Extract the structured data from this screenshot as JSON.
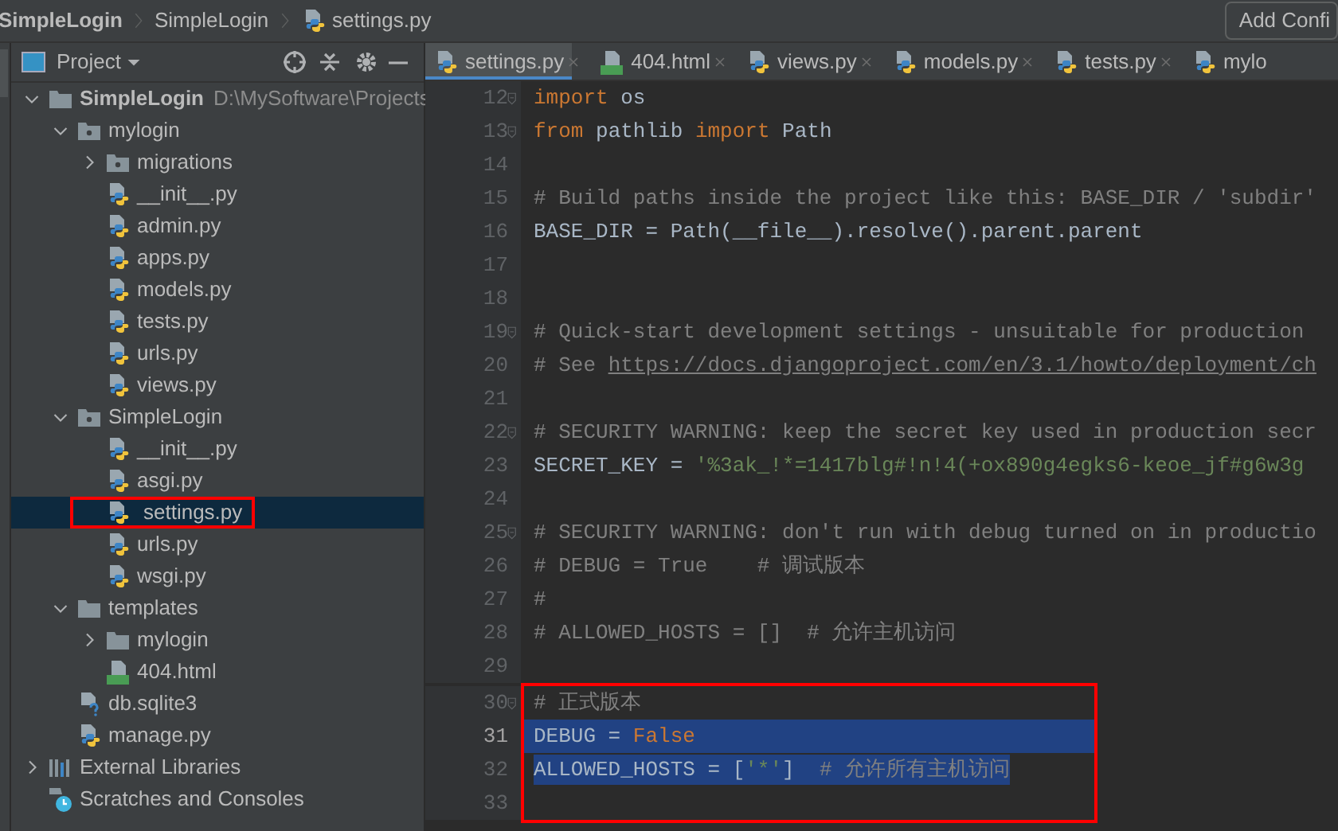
{
  "breadcrumb": [
    {
      "label": "SimpleLogin",
      "kind": "plain"
    },
    {
      "label": "SimpleLogin",
      "kind": "plain"
    },
    {
      "label": "settings.py",
      "kind": "python"
    }
  ],
  "toolbar_button": "Add Confi",
  "project_panel": {
    "title": "Project",
    "tree": [
      {
        "label": "SimpleLogin",
        "path": "D:\\MySoftware\\Projects",
        "kind": "folder",
        "expanded": true,
        "selected": false,
        "annotated": false,
        "children": [
          {
            "label": "mylogin",
            "kind": "package",
            "expanded": true,
            "selected": false,
            "annotated": false,
            "children": [
              {
                "label": "migrations",
                "kind": "package",
                "expanded": false,
                "selected": false,
                "annotated": false
              },
              {
                "label": "__init__.py",
                "kind": "python",
                "selected": false,
                "annotated": false
              },
              {
                "label": "admin.py",
                "kind": "python",
                "selected": false,
                "annotated": false
              },
              {
                "label": "apps.py",
                "kind": "python",
                "selected": false,
                "annotated": false
              },
              {
                "label": "models.py",
                "kind": "python",
                "selected": false,
                "annotated": false
              },
              {
                "label": "tests.py",
                "kind": "python",
                "selected": false,
                "annotated": false
              },
              {
                "label": "urls.py",
                "kind": "python",
                "selected": false,
                "annotated": false
              },
              {
                "label": "views.py",
                "kind": "python",
                "selected": false,
                "annotated": false
              }
            ]
          },
          {
            "label": "SimpleLogin",
            "kind": "package",
            "expanded": true,
            "selected": false,
            "annotated": false,
            "children": [
              {
                "label": "__init__.py",
                "kind": "python",
                "selected": false,
                "annotated": false
              },
              {
                "label": "asgi.py",
                "kind": "python",
                "selected": false,
                "annotated": false
              },
              {
                "label": "settings.py",
                "kind": "python",
                "selected": true,
                "annotated": true
              },
              {
                "label": "urls.py",
                "kind": "python",
                "selected": false,
                "annotated": false
              },
              {
                "label": "wsgi.py",
                "kind": "python",
                "selected": false,
                "annotated": false
              }
            ]
          },
          {
            "label": "templates",
            "kind": "folder",
            "expanded": true,
            "selected": false,
            "annotated": false,
            "children": [
              {
                "label": "mylogin",
                "kind": "folder",
                "expanded": false,
                "selected": false,
                "annotated": false
              },
              {
                "label": "404.html",
                "kind": "html",
                "selected": false,
                "annotated": false
              }
            ]
          },
          {
            "label": "db.sqlite3",
            "kind": "unknown",
            "selected": false,
            "annotated": false
          },
          {
            "label": "manage.py",
            "kind": "python",
            "selected": false,
            "annotated": false
          }
        ]
      },
      {
        "label": "External Libraries",
        "kind": "libraries",
        "expanded": false,
        "selected": false,
        "annotated": false
      },
      {
        "label": "Scratches and Consoles",
        "kind": "scratches",
        "selected": false,
        "annotated": false
      }
    ]
  },
  "tabs": [
    {
      "label": "settings.py",
      "kind": "python",
      "selected": true
    },
    {
      "label": "404.html",
      "kind": "html",
      "selected": false
    },
    {
      "label": "views.py",
      "kind": "python",
      "selected": false
    },
    {
      "label": "models.py",
      "kind": "python",
      "selected": false
    },
    {
      "label": "tests.py",
      "kind": "python",
      "selected": false
    },
    {
      "label": "mylo",
      "kind": "python",
      "selected": false
    }
  ],
  "code_lines": [
    {
      "number": "12",
      "fold": true,
      "current": false,
      "selected": false,
      "boxed": false,
      "tokens": [
        {
          "kind": "keyword",
          "text": "import"
        },
        {
          "kind": "plain",
          "text": " os"
        }
      ]
    },
    {
      "number": "13",
      "fold": true,
      "current": false,
      "selected": false,
      "boxed": false,
      "tokens": [
        {
          "kind": "keyword",
          "text": "from"
        },
        {
          "kind": "plain",
          "text": " pathlib "
        },
        {
          "kind": "keyword",
          "text": "import"
        },
        {
          "kind": "plain",
          "text": " Path"
        }
      ]
    },
    {
      "number": "14",
      "fold": false,
      "current": false,
      "selected": false,
      "boxed": false
    },
    {
      "number": "15",
      "fold": false,
      "current": false,
      "selected": false,
      "boxed": false,
      "tokens": [
        {
          "kind": "comment",
          "text": "# Build paths inside the project like this: BASE_DIR / 'subdir'"
        }
      ]
    },
    {
      "number": "16",
      "fold": false,
      "current": false,
      "selected": false,
      "boxed": false,
      "tokens": [
        {
          "kind": "plain",
          "text": "BASE_DIR = Path(__file__).resolve().parent.parent"
        }
      ]
    },
    {
      "number": "17",
      "fold": false,
      "current": false,
      "selected": false,
      "boxed": false
    },
    {
      "number": "18",
      "fold": false,
      "current": false,
      "selected": false,
      "boxed": false
    },
    {
      "number": "19",
      "fold": true,
      "current": false,
      "selected": false,
      "boxed": false,
      "tokens": [
        {
          "kind": "comment",
          "text": "# Quick-start development settings - unsuitable for production"
        }
      ]
    },
    {
      "number": "20",
      "fold": false,
      "current": false,
      "selected": false,
      "boxed": false,
      "tokens": [
        {
          "kind": "comment",
          "text": "# See "
        },
        {
          "kind": "link",
          "text": "https://docs.djangoproject.com/en/3.1/howto/deployment/ch"
        }
      ]
    },
    {
      "number": "21",
      "fold": false,
      "current": false,
      "selected": false,
      "boxed": false
    },
    {
      "number": "22",
      "fold": true,
      "current": false,
      "selected": false,
      "boxed": false,
      "tokens": [
        {
          "kind": "comment",
          "text": "# SECURITY WARNING: keep the secret key used in production secr"
        }
      ]
    },
    {
      "number": "23",
      "fold": false,
      "current": false,
      "selected": false,
      "boxed": false,
      "tokens": [
        {
          "kind": "plain",
          "text": "SECRET_KEY = "
        },
        {
          "kind": "string",
          "text": "'%3ak_!*=1417blg#!n!4(+ox890g4egks6-keoe_jf#g6w3g"
        }
      ]
    },
    {
      "number": "24",
      "fold": false,
      "current": false,
      "selected": false,
      "boxed": false
    },
    {
      "number": "25",
      "fold": true,
      "current": false,
      "selected": false,
      "boxed": false,
      "tokens": [
        {
          "kind": "comment",
          "text": "# SECURITY WARNING: don't run with debug turned on in productio"
        }
      ]
    },
    {
      "number": "26",
      "fold": false,
      "current": false,
      "selected": false,
      "boxed": false,
      "tokens": [
        {
          "kind": "comment",
          "text": "# DEBUG = True    # 调试版本"
        }
      ]
    },
    {
      "number": "27",
      "fold": false,
      "current": false,
      "selected": false,
      "boxed": false,
      "tokens": [
        {
          "kind": "comment",
          "text": "#"
        }
      ]
    },
    {
      "number": "28",
      "fold": false,
      "current": false,
      "selected": false,
      "boxed": false,
      "tokens": [
        {
          "kind": "comment",
          "text": "# ALLOWED_HOSTS = []  # 允许主机访问"
        }
      ]
    },
    {
      "number": "29",
      "fold": false,
      "current": false,
      "selected": false,
      "boxed": false
    },
    {
      "number": "30",
      "fold": true,
      "current": false,
      "selected": false,
      "boxed": true,
      "tokens": [
        {
          "kind": "comment",
          "text": "# 正式版本"
        }
      ]
    },
    {
      "number": "31",
      "fold": false,
      "current": true,
      "selected": true,
      "boxed": true,
      "tokens": [
        {
          "kind": "plain",
          "text": "DEBUG = "
        },
        {
          "kind": "keyword",
          "text": "False"
        }
      ]
    },
    {
      "number": "32",
      "fold": false,
      "current": false,
      "selected": true,
      "boxed": true,
      "tokens": [
        {
          "kind": "plain",
          "text": "ALLOWED_HOSTS = ["
        },
        {
          "kind": "string",
          "text": "'*'"
        },
        {
          "kind": "plain",
          "text": "]  "
        },
        {
          "kind": "comment",
          "text": "# 允许所有主机访问"
        }
      ]
    },
    {
      "number": "33",
      "fold": false,
      "current": false,
      "selected": false,
      "boxed": true
    }
  ]
}
